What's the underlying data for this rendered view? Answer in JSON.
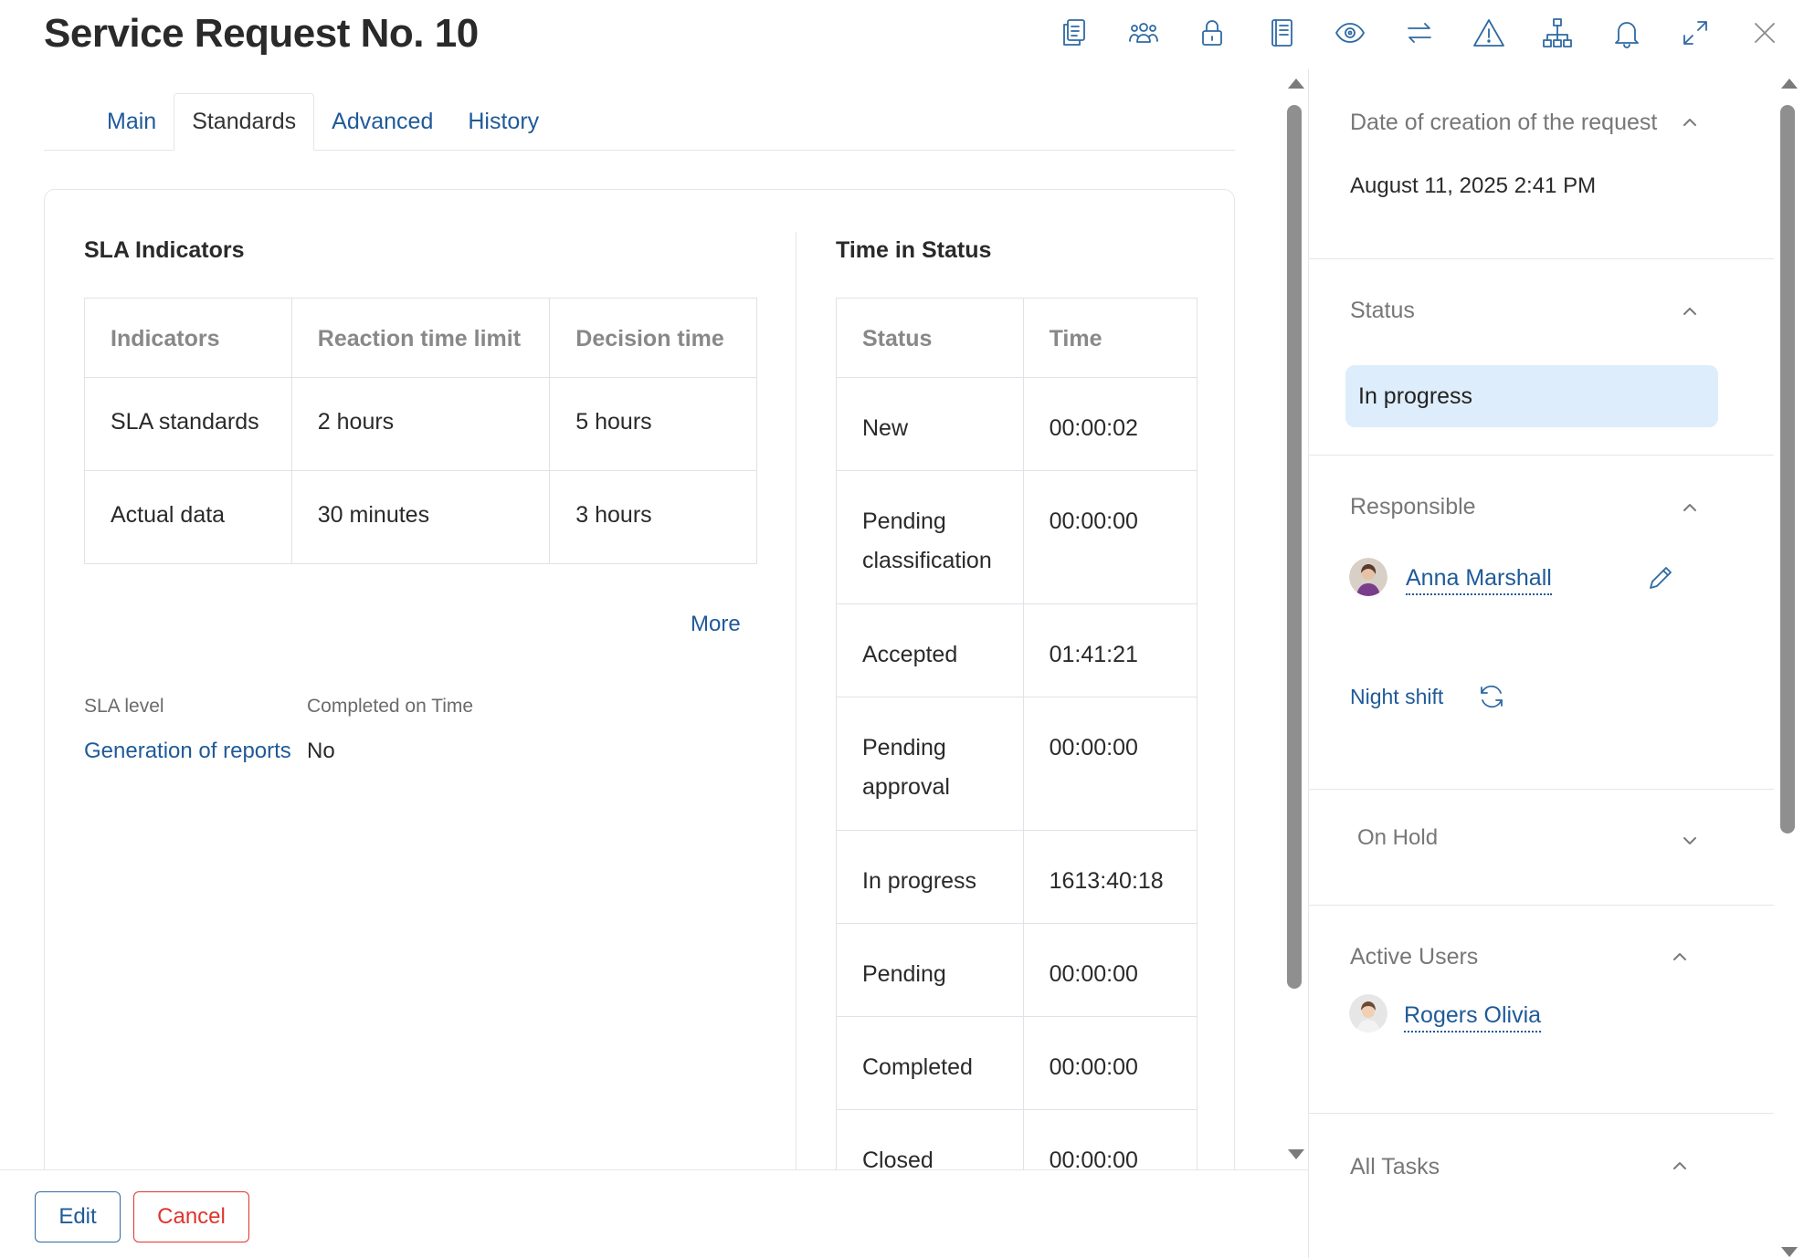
{
  "header": {
    "title": "Service Request No. 10",
    "toolbar": [
      {
        "name": "copy-icon"
      },
      {
        "name": "users-icon"
      },
      {
        "name": "lock-icon"
      },
      {
        "name": "book-icon"
      },
      {
        "name": "eye-icon"
      },
      {
        "name": "transfer-icon"
      },
      {
        "name": "warning-icon"
      },
      {
        "name": "hierarchy-icon"
      },
      {
        "name": "bell-icon"
      },
      {
        "name": "expand-icon"
      },
      {
        "name": "close-icon"
      }
    ]
  },
  "tabs": [
    {
      "label": "Main",
      "active": false
    },
    {
      "label": "Standards",
      "active": true
    },
    {
      "label": "Advanced",
      "active": false
    },
    {
      "label": "History",
      "active": false
    }
  ],
  "sla": {
    "title": "SLA Indicators",
    "headers": [
      "Indicators",
      "Reaction time limit",
      "Decision time"
    ],
    "rows": [
      [
        "SLA standards",
        "2 hours",
        "5 hours"
      ],
      [
        "Actual data",
        "30 minutes",
        "3 hours"
      ]
    ],
    "more_label": "More",
    "sla_level_label": "SLA level",
    "completed_label": "Completed on Time",
    "level_link": "Generation of reports",
    "completed_value": "No"
  },
  "time_in_status": {
    "title": "Time in Status",
    "headers": [
      "Status",
      "Time"
    ],
    "rows": [
      {
        "status": "New",
        "time": "00:00:02"
      },
      {
        "status": "Pending classification",
        "time": "00:00:00"
      },
      {
        "status": "Accepted",
        "time": "01:41:21"
      },
      {
        "status": "Pending approval",
        "time": "00:00:00"
      },
      {
        "status": "In progress",
        "time": "1613:40:18"
      },
      {
        "status": "Pending",
        "time": "00:00:00"
      },
      {
        "status": "Completed",
        "time": "00:00:00"
      },
      {
        "status": "Closed",
        "time": "00:00:00"
      }
    ]
  },
  "footer": {
    "edit_label": "Edit",
    "cancel_label": "Cancel"
  },
  "side": {
    "date_title": "Date of creation of the request",
    "date_value": "August 11, 2025 2:41 PM",
    "status_title": "Status",
    "status_value": "In progress",
    "responsible_title": "Responsible",
    "responsible_name": "Anna Marshall",
    "shift_label": "Night shift",
    "onhold_title": "On Hold",
    "active_users_title": "Active Users",
    "active_user_name": "Rogers Olivia",
    "all_tasks_title": "All Tasks"
  },
  "colors": {
    "link": "#1f5a99",
    "accent": "#2f6aa3",
    "cancel": "#e0342c",
    "status_pill": "#deedfb"
  }
}
